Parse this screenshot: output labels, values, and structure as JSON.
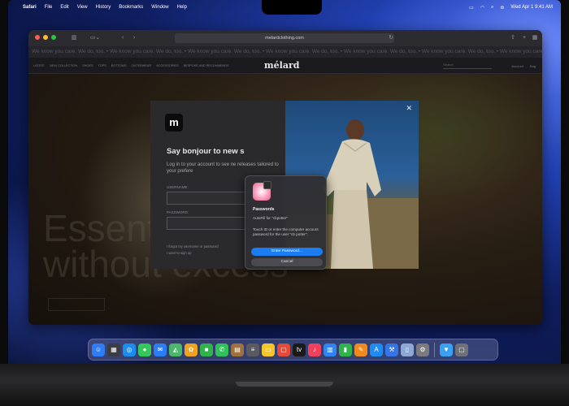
{
  "menubar": {
    "apple_glyph": "",
    "app_name": "Safari",
    "menus": [
      "File",
      "Edit",
      "View",
      "History",
      "Bookmarks",
      "Window",
      "Help"
    ],
    "clock": "Wed Apr 1  9:41 AM"
  },
  "safari": {
    "url": "melardclothing.com",
    "banner_text": "We know you care. We do, too.   •   We know you care. We do, too.   •   We know you care. We do, too.   •   We know you care. We do, too.   •   We know you care. We do, too.   •   We know you care. We do, too.   •   We know you care. We do, too."
  },
  "site": {
    "logo": "mélard",
    "nav": [
      "LATEST",
      "NEW COLLECTION",
      "SHOES",
      "TOPS",
      "BOTTOMS",
      "OUTERWEAR",
      "ACCESSORIES",
      "BESPOKE AND RECOMMENDS"
    ],
    "search_label": "Search",
    "right_links": [
      "Account",
      "Bag"
    ],
    "hero_line1": "Essentials",
    "hero_line2": "without excess"
  },
  "modal": {
    "logo_letter": "m",
    "title": "Say bonjour to new s",
    "description": "Log in to your account to see ne releases tailored to your prefere",
    "username_label": "USERNAME:",
    "password_label": "PASSWORD:",
    "forgot_link": "I forgot my username or password",
    "signup_link": "I want to sign up",
    "close_glyph": "✕"
  },
  "password_popup": {
    "title": "Passwords",
    "subtitle": "AutoFill for \"cbpotter\"",
    "body": "Touch ID or enter the computer account password for the user \"cb potter\".",
    "primary_button": "Enter Password...",
    "secondary_button": "Cancel"
  },
  "dock": {
    "apps": [
      {
        "name": "finder",
        "color": "#2f7df6",
        "glyph": "☺"
      },
      {
        "name": "launchpad",
        "color": "#3c3c44",
        "glyph": "▦"
      },
      {
        "name": "safari",
        "color": "#1b8cf0",
        "glyph": "◎"
      },
      {
        "name": "messages",
        "color": "#34c759",
        "glyph": "●"
      },
      {
        "name": "mail",
        "color": "#2a7ef5",
        "glyph": "✉"
      },
      {
        "name": "maps",
        "color": "#4cb76b",
        "glyph": "◭"
      },
      {
        "name": "photos",
        "color": "#f3a21f",
        "glyph": "✿"
      },
      {
        "name": "facetime",
        "color": "#2fb34a",
        "glyph": "■"
      },
      {
        "name": "phone",
        "color": "#30c25a",
        "glyph": "✆"
      },
      {
        "name": "contacts",
        "color": "#a0703e",
        "glyph": "▤"
      },
      {
        "name": "reminders",
        "color": "#5a5a60",
        "glyph": "≡"
      },
      {
        "name": "notes",
        "color": "#f5c52a",
        "glyph": "▭"
      },
      {
        "name": "calendar",
        "color": "#e24a3a",
        "glyph": "▢"
      },
      {
        "name": "tv",
        "color": "#1a1a1a",
        "glyph": "tv"
      },
      {
        "name": "music",
        "color": "#f2405a",
        "glyph": "♪"
      },
      {
        "name": "keynote",
        "color": "#2f86f2",
        "glyph": "▥"
      },
      {
        "name": "numbers",
        "color": "#2fb34a",
        "glyph": "▮"
      },
      {
        "name": "pages",
        "color": "#f08a1a",
        "glyph": "✎"
      },
      {
        "name": "app-store",
        "color": "#1d8cf2",
        "glyph": "A"
      },
      {
        "name": "xcode",
        "color": "#3575e8",
        "glyph": "⚒"
      },
      {
        "name": "preview",
        "color": "#8fa8d8",
        "glyph": "▯"
      },
      {
        "name": "system-settings",
        "color": "#7a7a80",
        "glyph": "⚙"
      }
    ],
    "trailing": [
      {
        "name": "downloads-folder",
        "color": "#3aa0f0",
        "glyph": "▼"
      },
      {
        "name": "trash",
        "color": "#707078",
        "glyph": "▢"
      }
    ]
  }
}
